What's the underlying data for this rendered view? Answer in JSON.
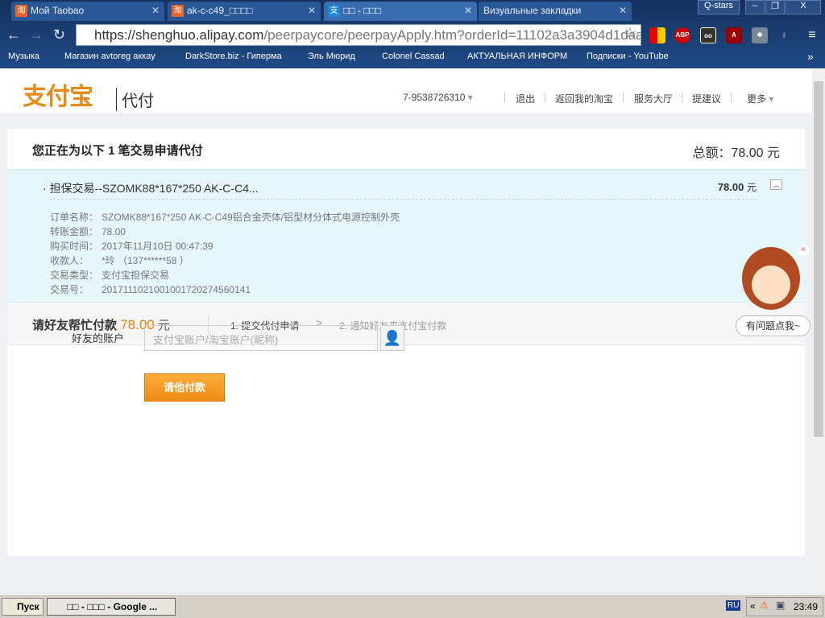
{
  "browser": {
    "tabs": [
      {
        "label": "Мой Taobao",
        "icon": "taobao-icon"
      },
      {
        "label": "ak-c-c49_□□□□",
        "icon": "taobao-icon"
      },
      {
        "label": "□□ - □□□",
        "icon": "alipay-icon"
      },
      {
        "label": "Визуальные закладки",
        "icon": ""
      }
    ],
    "profile": "Q-stars",
    "url_host": "https://shenghuo.alipay.com",
    "url_path": "/peerpaycore/peerpayApply.htm?orderId=11102a3a3904d1daa",
    "extensions": {
      "abp": "ABP"
    },
    "bookmarks": [
      "Музыка",
      "Магазин avtoreg аккау",
      "DarkStore.biz - Гиперма",
      "Эль Мюрид",
      "Colonel Cassad",
      "АКТУАЛЬНАЯ ИНФОРМ",
      "Подписки - YouTube"
    ],
    "more": "»"
  },
  "header": {
    "logo": "支付宝",
    "product": "代付",
    "account": "7-9538726310",
    "nav": [
      "退出",
      "返回我的淘宝",
      "服务大厅",
      "提建议",
      "更多"
    ]
  },
  "summary": {
    "title": "您正在为以下 1 笔交易申请代付",
    "total_label": "总额：",
    "total": "78.00",
    "currency": "元"
  },
  "order": {
    "title": "担保交易--SZOMK88*167*250 AK-C-C4...",
    "amount": "78.00",
    "currency": "元",
    "rows": [
      {
        "k": "订单名称：",
        "v": "SZOMK88*167*250 AK-C-C49铝合金壳体/铝型材分体式电源控制外壳"
      },
      {
        "k": "转账金额：",
        "v": "78.00"
      },
      {
        "k": "购买时间：",
        "v": "2017年11月10日 00:47:39"
      },
      {
        "k": "收款人：",
        "v": "*玲 （137******58 ）"
      },
      {
        "k": "交易类型：",
        "v": "支付宝担保交易"
      },
      {
        "k": "交易号：",
        "v": "2017111021001001720274560141"
      }
    ]
  },
  "request": {
    "label": "请好友帮忙付款",
    "amount": "78.00",
    "currency": "元",
    "steps": [
      "1. 提交代付申请",
      "2. 通知好友来支付宝付款"
    ],
    "arrow": ">"
  },
  "form": {
    "label": "好友的账户",
    "placeholder": "支付宝账户/淘宝账户(昵称)",
    "submit": "请他付款"
  },
  "helper": {
    "label": "有问题点我~",
    "close": "×"
  },
  "taskbar": {
    "start": "Пуск",
    "task": "□□ - □□□ - Google ...",
    "lang": "RU",
    "clock": "23:49"
  }
}
